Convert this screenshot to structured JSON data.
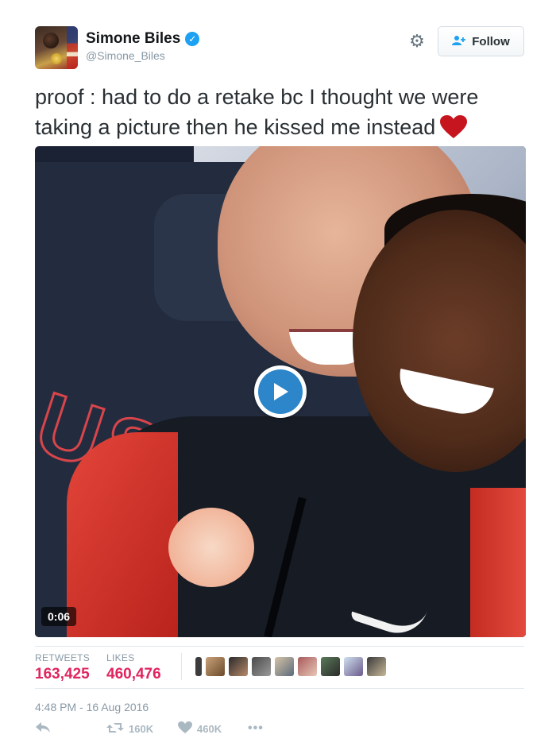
{
  "author": {
    "display_name": "Simone Biles",
    "handle": "@Simone_Biles",
    "verified_icon": "verified-badge-icon"
  },
  "header": {
    "settings_icon": "gear-icon",
    "follow_label": "Follow"
  },
  "tweet": {
    "text": "proof : had to do a retake bc I thought we were taking a picture then he kissed me instead",
    "emoji": "red-heart-icon"
  },
  "media": {
    "type": "video",
    "duration": "0:06",
    "play_icon": "play-icon"
  },
  "stats": {
    "retweets_label": "RETWEETS",
    "retweets_value": "163,425",
    "likes_label": "LIKES",
    "likes_value": "460,476"
  },
  "timestamp": "4:48 PM - 16 Aug 2016",
  "actions": {
    "reply_icon": "reply-icon",
    "retweet_count": "160K",
    "like_count": "460K",
    "more_icon": "more-icon"
  },
  "colors": {
    "accent": "#1da1f2",
    "likes_red": "#e0245e",
    "muted": "#8899a6",
    "play_blue": "#2c86c9"
  }
}
